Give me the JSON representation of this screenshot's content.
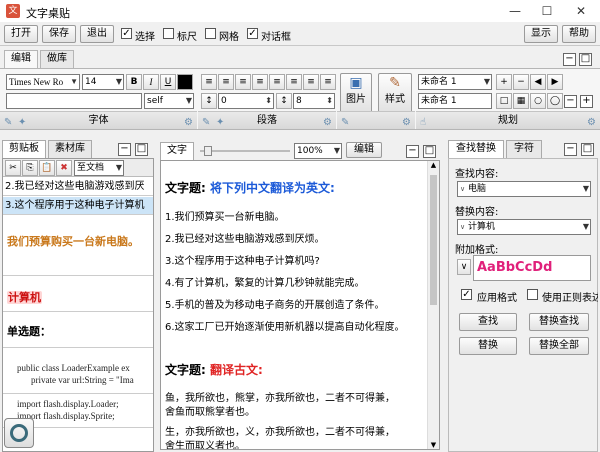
{
  "app": {
    "title": "文字桌贴"
  },
  "toolbar": {
    "open": "打开",
    "save": "保存",
    "exit": "退出",
    "select": "选择",
    "ruler": "标尺",
    "grid": "网格",
    "dialog": "对话框",
    "show": "显示",
    "help": "帮助"
  },
  "ribbon": {
    "tabs": [
      "编辑",
      "做库"
    ],
    "font_name": "Times New Ro",
    "font_size": "14",
    "bold": "B",
    "italic": "I",
    "underline": "U",
    "style_value": "self",
    "spacing_1": "0",
    "spacing_2": "8",
    "picture": "图片",
    "style": "样式",
    "preset_select": "未命名 1",
    "preset_name": "未命名 1",
    "group_font": "字体",
    "group_paragraph": "段落",
    "group_plan": "规划"
  },
  "left": {
    "tabs": [
      "剪贴板",
      "素材库"
    ],
    "to_text": "至文档",
    "lines": [
      "2.我已经对这些电脑游戏感到厌",
      "3.这个程序用于这种电子计算机"
    ],
    "note1": "我们预算购买一台新电脑。",
    "note2": "计算机",
    "section": "单选题：",
    "code": [
      "public class LoaderExample ex",
      "private var url:String = \"Ima",
      "import flash.display.Loader;",
      "import flash.display.Sprite;"
    ]
  },
  "center": {
    "tab": "文字",
    "zoom": "100%",
    "edit": "编辑",
    "heading1": "文字题:",
    "heading1_text": "将下列中文翻译为英文:",
    "items": [
      "1.我们预算买一台新电脑。",
      "2.我已经对这些电脑游戏感到厌烦。",
      "3.这个程序用于这种电子计算机吗?",
      "4.有了计算机，繁复的计算几秒钟就能完成。",
      "5.手机的普及为移动电子商务的开展创造了条件。",
      "6.这家工厂已开始逐渐使用新机器以提高自动化程度。"
    ],
    "heading2": "文字题:",
    "heading2_text": "翻译古文:",
    "poem1_a": "鱼，我所欲也，熊掌，亦我所欲也，二者不可得兼，",
    "poem1_b": "舍鱼而取熊掌者也。",
    "poem2_a": "生，亦我所欲也，义，亦我所欲也，二者不可得兼，",
    "poem2_b": "舍生而取义者也。"
  },
  "right": {
    "tabs": [
      "查找替换",
      "字符"
    ],
    "find_label": "查找内容:",
    "find_value": "电脑",
    "replace_label": "替换内容:",
    "replace_value": "计算机",
    "format_label": "附加格式:",
    "format_sample": "AaBbCcDd",
    "apply_format": "应用格式",
    "use_regex": "使用正则表达",
    "find": "查找",
    "find_replace": "替换查找",
    "replace": "替换",
    "replace_all": "替换全部"
  }
}
